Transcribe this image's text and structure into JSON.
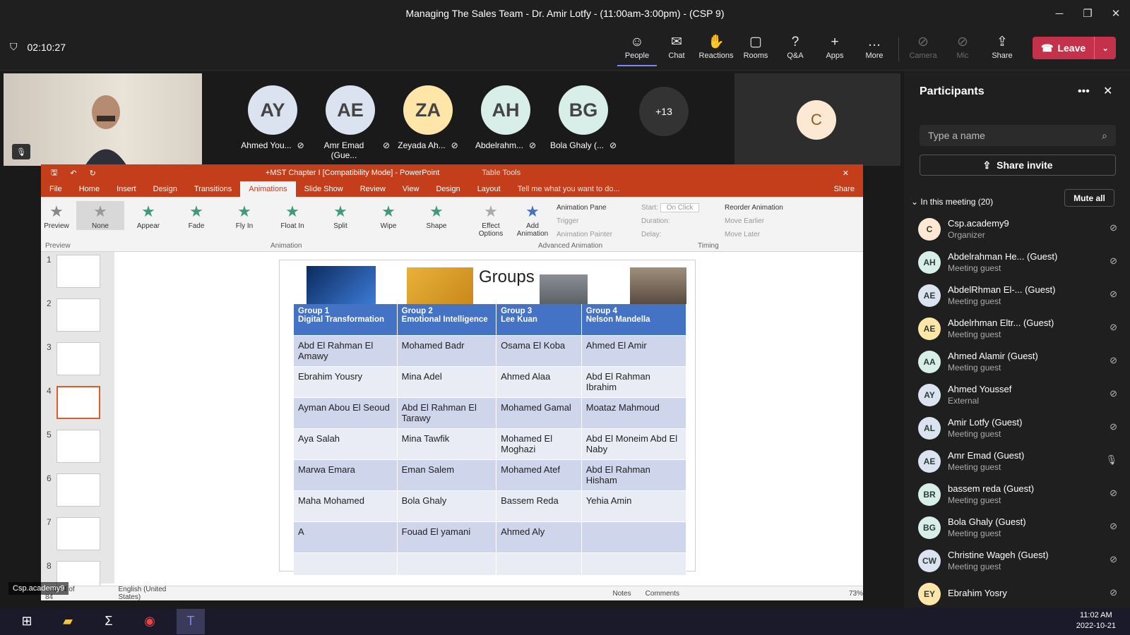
{
  "window": {
    "title": "Managing The Sales Team - Dr. Amir Lotfy - (11:00am-3:00pm) - (CSP 9)"
  },
  "meeting": {
    "timer": "02:10:27",
    "toolbar": [
      {
        "label": "People",
        "icon": "people-icon"
      },
      {
        "label": "Chat",
        "icon": "chat-icon"
      },
      {
        "label": "Reactions",
        "icon": "reactions-icon"
      },
      {
        "label": "Rooms",
        "icon": "rooms-icon"
      },
      {
        "label": "Q&A",
        "icon": "qa-icon"
      },
      {
        "label": "Apps",
        "icon": "apps-icon"
      },
      {
        "label": "More",
        "icon": "more-icon"
      }
    ],
    "device": [
      {
        "label": "Camera"
      },
      {
        "label": "Mic"
      },
      {
        "label": "Share"
      }
    ],
    "leave": "Leave"
  },
  "gallery": [
    {
      "initials": "AY",
      "name": "Ahmed You...",
      "color": "#dbe3f0"
    },
    {
      "initials": "AE",
      "name": "Amr Emad (Gue...",
      "color": "#dbe3f0"
    },
    {
      "initials": "ZA",
      "name": "Zeyada Ah...",
      "color": "#fde6a8"
    },
    {
      "initials": "AH",
      "name": "Abdelrahm...",
      "color": "#d7efe8"
    },
    {
      "initials": "BG",
      "name": "Bola Ghaly (...",
      "color": "#d7efe8"
    }
  ],
  "overflow": "+13",
  "tile_c": "C",
  "cam_name": "Csp.academy9",
  "ppt": {
    "title": "+MST Chapter I [Compatibility Mode] - PowerPoint",
    "table_tools": "Table Tools",
    "tabs": [
      "File",
      "Home",
      "Insert",
      "Design",
      "Transitions",
      "Animations",
      "Slide Show",
      "Review",
      "View",
      "Design",
      "Layout"
    ],
    "tell": "Tell me what you want to do...",
    "share": "Share",
    "animations": [
      "None",
      "Appear",
      "Fade",
      "Fly In",
      "Float In",
      "Split",
      "Wipe",
      "Shape"
    ],
    "preview": "Preview",
    "effect": "Effect Options",
    "add": "Add Animation",
    "pane": "Animation Pane",
    "trigger": "Trigger",
    "painter": "Animation Painter",
    "start": "Start:",
    "start_val": "On Click",
    "duration": "Duration:",
    "delay": "Delay:",
    "reorder": "Reorder Animation",
    "earlier": "Move Earlier",
    "later": "Move Later",
    "grp_preview": "Preview",
    "grp_anim": "Animation",
    "grp_adv": "Advanced Animation",
    "grp_timing": "Timing",
    "slides": [
      "1",
      "2",
      "3",
      "4",
      "5",
      "6",
      "7",
      "8"
    ],
    "status": "Slide 4 of 84",
    "lang": "English (United States)",
    "notes": "Notes",
    "comments": "Comments",
    "zoom": "73%"
  },
  "slide": {
    "title": "Groups",
    "headers": [
      [
        "Group 1",
        "Digital Transformation"
      ],
      [
        "Group 2",
        "Emotional Intelligence"
      ],
      [
        "Group 3",
        "Lee Kuan"
      ],
      [
        "Group 4",
        "Nelson Mandella"
      ]
    ],
    "rows": [
      [
        "Abd El Rahman El Amawy",
        "Mohamed Badr",
        "Osama El Koba",
        "Ahmed El Amir"
      ],
      [
        "Ebrahim Yousry",
        "Mina Adel",
        "Ahmed Alaa",
        "Abd El Rahman Ibrahim"
      ],
      [
        "Ayman Abou El Seoud",
        "Abd El Rahman El Tarawy",
        "Mohamed Gamal",
        "Moataz Mahmoud"
      ],
      [
        "Aya Salah",
        "Mina Tawfik",
        "Mohamed El Moghazi",
        "Abd El Moneim Abd El Naby"
      ],
      [
        "Marwa Emara",
        "Eman Salem",
        "Mohamed Atef",
        "Abd El Rahman Hisham"
      ],
      [
        "Maha Mohamed",
        "Bola Ghaly",
        "Bassem Reda",
        "Yehia Amin"
      ],
      [
        "A",
        "Fouad El yamani",
        "Ahmed Aly",
        ""
      ],
      [
        "",
        "",
        "",
        ""
      ]
    ]
  },
  "participants": {
    "title": "Participants",
    "search": "Type a name",
    "invite": "Share invite",
    "section": "In this meeting (20)",
    "mute_all": "Mute all",
    "list": [
      {
        "i": "C",
        "n": "Csp.academy9",
        "r": "Organizer",
        "c": "#fde9d3"
      },
      {
        "i": "AH",
        "n": "Abdelrahman He... (Guest)",
        "r": "Meeting guest",
        "c": "#d7efe8"
      },
      {
        "i": "AE",
        "n": "AbdelRhman El-... (Guest)",
        "r": "Meeting guest",
        "c": "#dbe3f0"
      },
      {
        "i": "AE",
        "n": "Abdelrhman Eltr... (Guest)",
        "r": "Meeting guest",
        "c": "#fde6a8"
      },
      {
        "i": "AA",
        "n": "Ahmed Alamir (Guest)",
        "r": "Meeting guest",
        "c": "#d7efe8"
      },
      {
        "i": "AY",
        "n": "Ahmed Youssef",
        "r": "External",
        "c": "#dbe3f0"
      },
      {
        "i": "AL",
        "n": "Amir Lotfy (Guest)",
        "r": "Meeting guest",
        "c": "#dbe3f0"
      },
      {
        "i": "AE",
        "n": "Amr Emad (Guest)",
        "r": "Meeting guest",
        "c": "#dbe3f0"
      },
      {
        "i": "BR",
        "n": "bassem reda (Guest)",
        "r": "Meeting guest",
        "c": "#d7efe8"
      },
      {
        "i": "BG",
        "n": "Bola Ghaly (Guest)",
        "r": "Meeting guest",
        "c": "#d7efe8"
      },
      {
        "i": "CW",
        "n": "Christine Wageh (Guest)",
        "r": "Meeting guest",
        "c": "#dbe3f0"
      },
      {
        "i": "EY",
        "n": "Ebrahim Yosry",
        "r": "",
        "c": "#fde6a8"
      }
    ]
  },
  "clock": {
    "time": "11:02 AM",
    "date": "2022-10-21"
  }
}
